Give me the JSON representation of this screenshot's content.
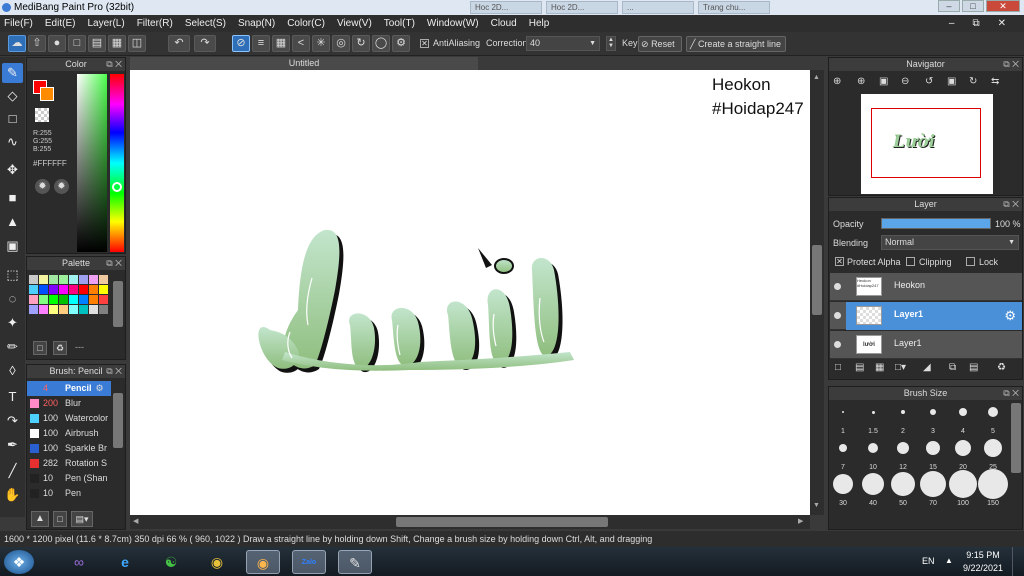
{
  "window": {
    "title": "MediBang Paint Pro (32bit)",
    "bg_tabs": [
      "Hoc 2D...",
      "Hoc 2D...",
      "...",
      "Trang chu..."
    ]
  },
  "menu": [
    "File(F)",
    "Edit(E)",
    "Layer(L)",
    "Filter(R)",
    "Select(S)",
    "Snap(N)",
    "Color(C)",
    "View(V)",
    "Tool(T)",
    "Window(W)",
    "Cloud",
    "Help"
  ],
  "toolbar": {
    "antialiasing_label": "AntiAliasing",
    "correction_label": "Correction",
    "correction_value": "40",
    "key_label": "Key",
    "reset_label": "Reset",
    "straight_line_label": "Create a straight line"
  },
  "color_panel": {
    "title": "Color",
    "r": "R:255",
    "g": "G:255",
    "b": "B:255",
    "hex": "#FFFFFF",
    "main_color": "#ff0000",
    "sub_color": "#ff8c00"
  },
  "palette_panel": {
    "title": "Palette",
    "colors": [
      "#c9c9c9",
      "#f3f3a0",
      "#a0e6a0",
      "#9cf09c",
      "#a0f0f0",
      "#a0a0f0",
      "#f0a0f0",
      "#f0c8a0",
      "#4dd0ff",
      "#0050ff",
      "#8000ff",
      "#ff00ff",
      "#ff0080",
      "#ff0000",
      "#ff8000",
      "#ffff00",
      "#ffa0c0",
      "#80ff80",
      "#00ff00",
      "#00c000",
      "#00ffff",
      "#0080ff",
      "#ff8000",
      "#ff4040",
      "#a0a0ff",
      "#ff80ff",
      "#ffff80",
      "#ffcc80",
      "#80ffff",
      "#00c0c0",
      "#e0e0e0",
      "#808080"
    ],
    "footer_text": "---"
  },
  "brush_panel": {
    "title": "Brush: Pencil",
    "brushes": [
      {
        "size": "4",
        "name": "Pencil",
        "color": "#3a7bd5"
      },
      {
        "size": "200",
        "name": "Blur",
        "color": "#ff8ac8"
      },
      {
        "size": "100",
        "name": "Watercolor",
        "color": "#4dd0ff"
      },
      {
        "size": "100",
        "name": "Airbrush",
        "color": "#ffffff"
      },
      {
        "size": "100",
        "name": "Sparkle Br",
        "color": "#2a5fd0"
      },
      {
        "size": "282",
        "name": "Rotation S",
        "color": "#e83030"
      },
      {
        "size": "10",
        "name": "Pen (Shan",
        "color": "#222222"
      },
      {
        "size": "10",
        "name": "Pen",
        "color": "#222222"
      }
    ]
  },
  "document": {
    "tab_title": "Untitled",
    "watermark_line1": "Heokon",
    "watermark_line2": "#Hoidap247",
    "lettering": "Lười"
  },
  "navigator": {
    "title": "Navigator"
  },
  "layer_panel": {
    "title": "Layer",
    "opacity_label": "Opacity",
    "opacity_value": "100 %",
    "opacity_fraction": 1.0,
    "blending_label": "Blending",
    "blending_value": "Normal",
    "protect_alpha_label": "Protect Alpha",
    "clipping_label": "Clipping",
    "lock_label": "Lock",
    "layers": [
      {
        "name": "Heokon",
        "thumb_text": "Heokon #Hoidap247"
      },
      {
        "name": "Layer1",
        "thumb_text": ""
      },
      {
        "name": "Layer1",
        "thumb_text": "lười"
      }
    ]
  },
  "brush_size_panel": {
    "title": "Brush Size",
    "sizes": [
      "1",
      "1.5",
      "2",
      "3",
      "4",
      "5",
      "7",
      "10",
      "12",
      "15",
      "20",
      "25",
      "30",
      "40",
      "50",
      "70",
      "100",
      "150"
    ]
  },
  "status": {
    "text": "1600 * 1200 pixel   (11.6 * 8.7cm)   350 dpi   66 %   ( 960, 1022 )   Draw a straight line by holding down Shift, Change a brush size by holding down Ctrl, Alt, and dragging"
  },
  "taskbar": {
    "lang": "EN",
    "time": "9:15 PM",
    "date": "9/22/2021",
    "zalo_label": "Zalo"
  }
}
